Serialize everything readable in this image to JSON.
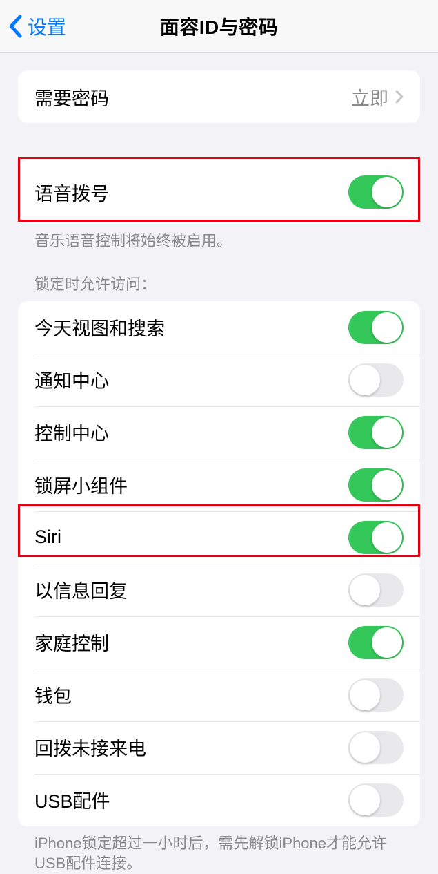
{
  "nav": {
    "back_label": "设置",
    "title": "面容ID与密码"
  },
  "groups": {
    "require": {
      "label": "需要密码",
      "value": "立即"
    },
    "voice_dial": {
      "label": "语音拨号",
      "enabled": true,
      "footer": "音乐语音控制将始终被启用。"
    },
    "lock_access": {
      "header": "锁定时允许访问：",
      "items": [
        {
          "id": "today-view",
          "label": "今天视图和搜索",
          "enabled": true
        },
        {
          "id": "notification-center",
          "label": "通知中心",
          "enabled": false
        },
        {
          "id": "control-center",
          "label": "控制中心",
          "enabled": true
        },
        {
          "id": "lockscreen-widgets",
          "label": "锁屏小组件",
          "enabled": true
        },
        {
          "id": "siri",
          "label": "Siri",
          "enabled": true
        },
        {
          "id": "reply-message",
          "label": "以信息回复",
          "enabled": false
        },
        {
          "id": "home-control",
          "label": "家庭控制",
          "enabled": true
        },
        {
          "id": "wallet",
          "label": "钱包",
          "enabled": false
        },
        {
          "id": "return-missed-calls",
          "label": "回拨未接来电",
          "enabled": false
        },
        {
          "id": "usb-accessories",
          "label": "USB配件",
          "enabled": false
        }
      ],
      "footer": "iPhone锁定超过一小时后，需先解锁iPhone才能允许USB配件连接。"
    }
  }
}
